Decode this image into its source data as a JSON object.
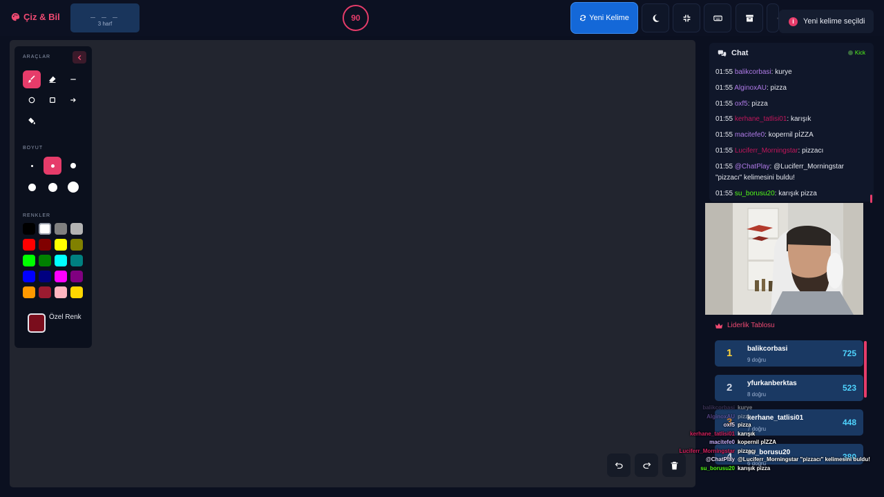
{
  "app": {
    "title": "Çiz & Bil"
  },
  "word": {
    "dashes": "_ _ _",
    "count": "3 harf"
  },
  "timer": {
    "value": "90"
  },
  "toolbar": {
    "new_word_label": "Yeni Kelime"
  },
  "toast": {
    "icon": "i",
    "text": "Yeni kelime seçildi"
  },
  "tools": {
    "section_tools": "ARAÇLAR",
    "section_size": "BOYUT",
    "section_colors": "RENKLER",
    "colors": [
      "#000000",
      "#ffffff",
      "#808080",
      "#b3b3b3",
      "#ff0000",
      "#800000",
      "#ffff00",
      "#808000",
      "#00ff00",
      "#008000",
      "#00ffff",
      "#008080",
      "#0000ff",
      "#000080",
      "#ff00ff",
      "#800080",
      "#ff9900",
      "#9b1b30",
      "#ffb6c1",
      "#ffd700"
    ],
    "custom_label": "Özel Renk",
    "custom_color": "#7a0d1c"
  },
  "chat": {
    "title": "Chat",
    "platform": "Kick",
    "messages": [
      {
        "time": "01:55",
        "user": "balikcorbasi",
        "color": "#b07be8",
        "text": "kurye"
      },
      {
        "time": "01:55",
        "user": "AlginoxAU",
        "color": "#b07be8",
        "text": "pizza"
      },
      {
        "time": "01:55",
        "user": "oxf5",
        "color": "#b07be8",
        "text": "pizza"
      },
      {
        "time": "01:55",
        "user": "kerhane_tatlisi01",
        "color": "#c2175b",
        "text": "karışık"
      },
      {
        "time": "01:55",
        "user": "macitefe0",
        "color": "#b07be8",
        "text": "kopernil pİZZA"
      },
      {
        "time": "01:55",
        "user": "Luciferr_Morningstar",
        "color": "#c2175b",
        "text": "pizzacı"
      },
      {
        "time": "01:55",
        "user": "@ChatPlay",
        "color": "#b07be8",
        "text": "@Luciferr_Morningstar \"pizzacı\" kelimesini buldu!"
      },
      {
        "time": "01:55",
        "user": "su_borusu20",
        "color": "#53fc18",
        "text": "karışık pizza"
      }
    ]
  },
  "leaderboard": {
    "title": "Liderlik Tablosu",
    "rows": [
      {
        "rank": "1",
        "name": "balikcorbasi",
        "sub": "9 doğru",
        "score": "725",
        "rank_color": "#ffd43b"
      },
      {
        "rank": "2",
        "name": "yfurkanberktas",
        "sub": "8 doğru",
        "score": "523",
        "rank_color": "#cfd6e4"
      },
      {
        "rank": "3",
        "name": "kerhane_tatlisi01",
        "sub": "7 doğru",
        "score": "448",
        "rank_color": "#cd7f32"
      },
      {
        "rank": "4",
        "name": "su_borusu20",
        "sub": "6 doğru",
        "score": "380",
        "rank_color": "#cfd6e4"
      }
    ]
  },
  "overlay": {
    "messages": [
      {
        "user": "balikcorbasi",
        "color": "#5c4a7a",
        "text": "kurye",
        "faded": true
      },
      {
        "user": "AlginoxAU",
        "color": "#8a64c8",
        "text": "pizza",
        "faded": true
      },
      {
        "user": "oxf5",
        "color": "#e8e0ff",
        "text": "pizza"
      },
      {
        "user": "kerhane_tatlisi01",
        "color": "#d4215f",
        "text": "karışık"
      },
      {
        "user": "macitefe0",
        "color": "#c9b2ff",
        "text": "kopernil pİZZA"
      },
      {
        "user": "Luciferr_Morningstar",
        "color": "#d4215f",
        "text": "pizzacı"
      },
      {
        "user": "@ChatPlay",
        "color": "#e8e0ff",
        "text": "@Luciferr_Morningstar \"pizzacı\" kelimesini buldu!"
      },
      {
        "user": "su_borusu20",
        "color": "#53fc18",
        "text": "karışık pizza"
      }
    ]
  }
}
